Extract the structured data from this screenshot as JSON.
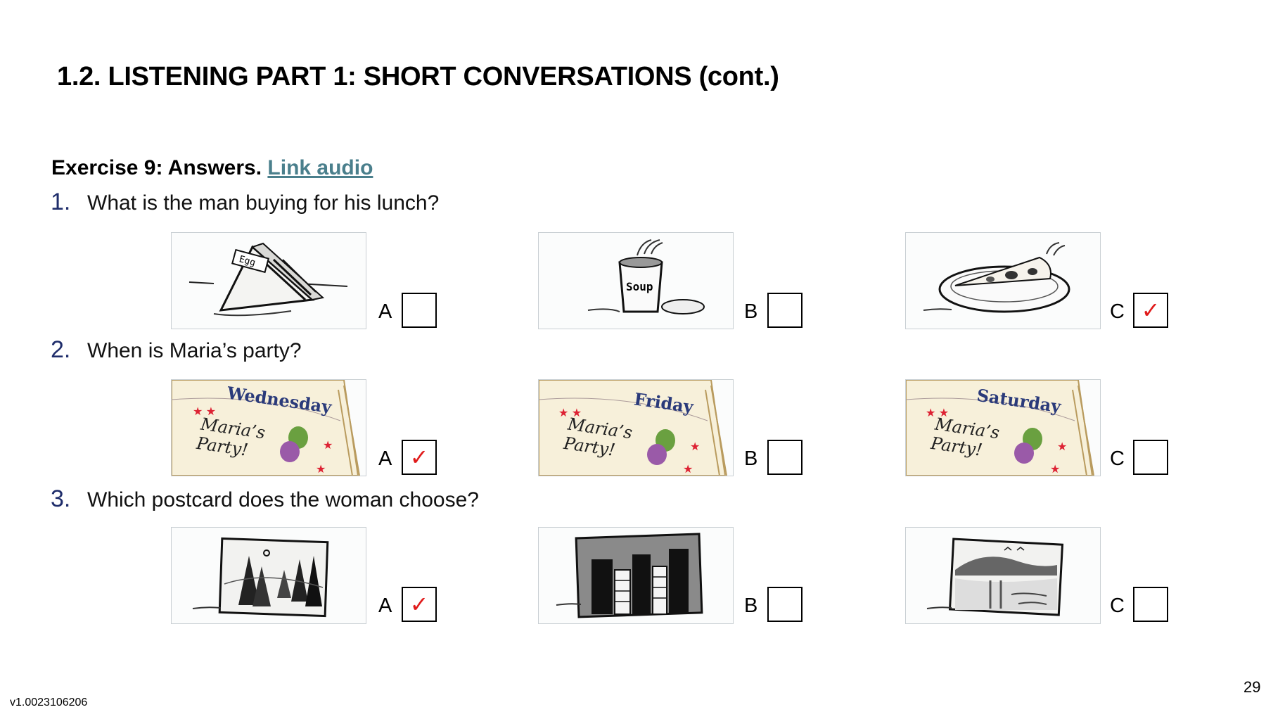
{
  "title": "1.2. LISTENING PART 1: SHORT CONVERSATIONS (cont.)",
  "exercise": {
    "heading": "Exercise 9: Answers.",
    "link": "Link audio"
  },
  "questions": [
    {
      "number": "1.",
      "text": "What is the man buying for his lunch?",
      "options": [
        {
          "letter": "A",
          "checked": false,
          "image": "egg-sandwich",
          "image_text": "Egg"
        },
        {
          "letter": "B",
          "checked": false,
          "image": "soup-cup",
          "image_text": "Soup"
        },
        {
          "letter": "C",
          "checked": true,
          "image": "pizza-slice"
        }
      ]
    },
    {
      "number": "2.",
      "text": "When is Maria’s party?",
      "options": [
        {
          "letter": "A",
          "checked": true,
          "image": "wednesday-invite",
          "day": "Wednesday",
          "note": [
            "Maria’s",
            "Party!"
          ]
        },
        {
          "letter": "B",
          "checked": false,
          "image": "friday-invite",
          "day": "Friday",
          "note": [
            "Maria’s",
            "Party!"
          ]
        },
        {
          "letter": "C",
          "checked": false,
          "image": "saturday-invite",
          "day": "Saturday",
          "note": [
            "Maria’s",
            "Party!"
          ]
        }
      ]
    },
    {
      "number": "3.",
      "text": "Which postcard does the woman choose?",
      "options": [
        {
          "letter": "A",
          "checked": true,
          "image": "forest-postcard"
        },
        {
          "letter": "B",
          "checked": false,
          "image": "city-postcard"
        },
        {
          "letter": "C",
          "checked": false,
          "image": "lake-postcard"
        }
      ]
    }
  ],
  "check_mark": "✓",
  "footer": {
    "version": "v1.0023106206",
    "page": "29"
  },
  "colors": {
    "check": "#e01b1b",
    "link": "#4a7f8c",
    "number": "#1f2d6b",
    "day": "#2a3a7a"
  }
}
